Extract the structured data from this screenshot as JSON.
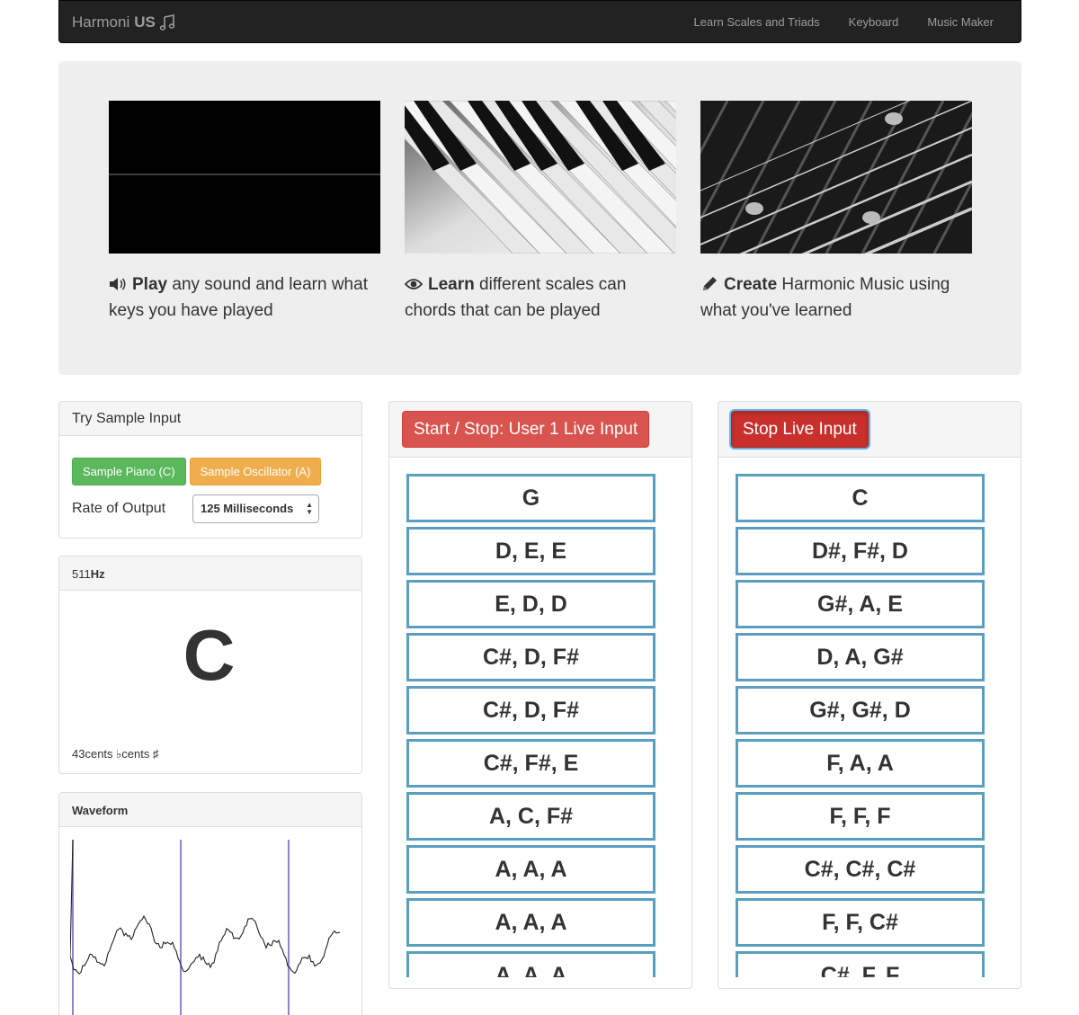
{
  "navbar": {
    "brand_prefix": "Harmoni",
    "brand_bold": "US",
    "links": [
      "Learn Scales and Triads",
      "Keyboard",
      "Music Maker"
    ]
  },
  "features": [
    {
      "icon": "volume-icon",
      "bold": "Play",
      "text": " any sound and learn what keys you have played"
    },
    {
      "icon": "eye-icon",
      "bold": "Learn",
      "text": " different scales can chords that can be played"
    },
    {
      "icon": "pencil-icon",
      "bold": "Create",
      "text": " Harmonic Music using what you've learned"
    }
  ],
  "sample_panel": {
    "title": "Try Sample Input",
    "piano_button": "Sample Piano (C)",
    "oscillator_button": "Sample Oscillator (A)",
    "rate_label": "Rate of Output",
    "rate_value": "125 Milliseconds"
  },
  "pitch_panel": {
    "frequency_value": "511",
    "frequency_unit": "Hz",
    "note": "C",
    "cents_text": "43cents ♭cents ♯"
  },
  "waveform_panel": {
    "title": "Waveform"
  },
  "live_panels": [
    {
      "button_label": "Start / Stop: User 1 Live Input",
      "chords": [
        "G",
        "D, E, E",
        "E, D, D",
        "C#, D, F#",
        "C#, D, F#",
        "C#, F#, E",
        "A, C, F#",
        "A, A, A",
        "A, A, A",
        "A, A, A"
      ]
    },
    {
      "button_label": "Stop Live Input",
      "chords": [
        "C",
        "D#, F#, D",
        "G#, A, E",
        "D, A, G#",
        "G#, G#, D",
        "F, A, A",
        "F, F, F",
        "C#, C#, C#",
        "F, F, C#",
        "C#, F, F"
      ]
    }
  ],
  "colors": {
    "navbar_bg": "#222222",
    "jumbotron_bg": "#eeeeee",
    "success": "#5cb85c",
    "warning": "#f0ad4e",
    "danger": "#d9534f",
    "chord_border": "#5a9fc0",
    "waveform_marker": "#6a5acd"
  }
}
